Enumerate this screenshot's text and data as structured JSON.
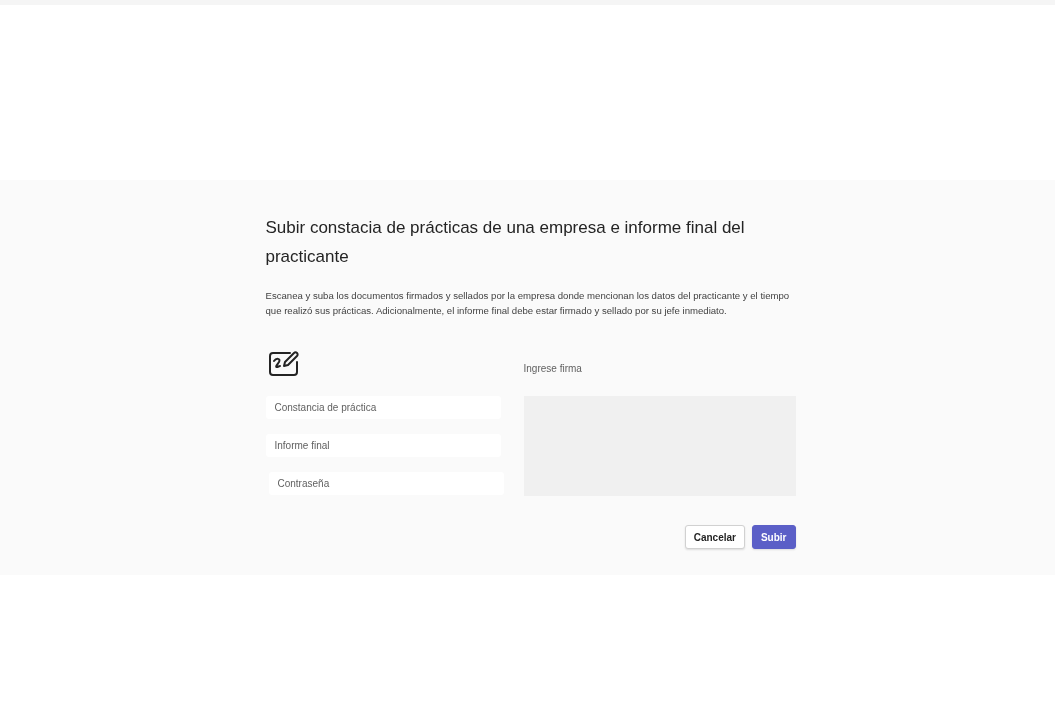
{
  "dialog": {
    "title": "Subir constacia de prácticas de una empresa e informe final del practicante",
    "description": "Escanea y suba los documentos firmados y sellados por la empresa donde mencionan los datos del practicante y el tiempo que realizó sus prácticas. Adicionalmente, el informe final debe estar firmado y sellado por su jefe inmediato.",
    "fields": [
      {
        "kind": "text",
        "placeholder": "Constancia de práctica"
      },
      {
        "kind": "text",
        "placeholder": "Informe final"
      },
      {
        "kind": "password",
        "placeholder": "Contraseña"
      }
    ],
    "signature": {
      "label": "Ingrese firma"
    },
    "buttons": [
      {
        "kind": "secondary",
        "label": "Cancelar"
      },
      {
        "kind": "primary",
        "label": "Subir"
      }
    ]
  }
}
